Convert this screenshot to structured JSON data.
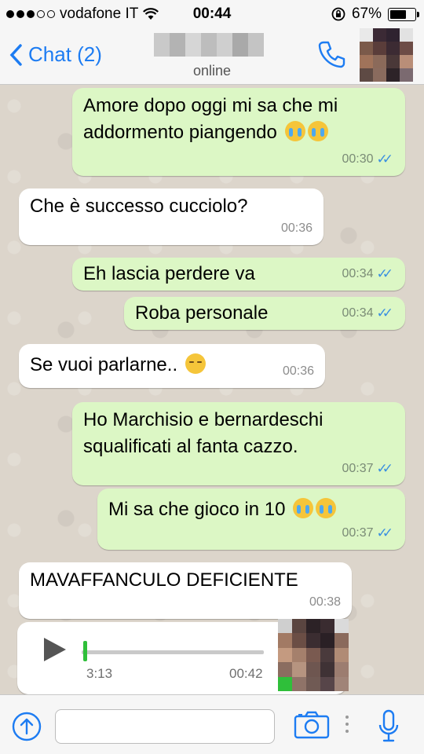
{
  "status_bar": {
    "carrier": "vodafone IT",
    "time": "00:44",
    "battery": "67%",
    "battery_level": 0.67,
    "signal_bars": 3
  },
  "header": {
    "back_label": "Chat (2)",
    "contact_status": "online"
  },
  "icons": {
    "back": "chevron-left-icon",
    "call": "phone-icon",
    "share": "upload-icon",
    "camera": "camera-icon",
    "mic": "microphone-icon",
    "play": "play-icon"
  },
  "colors": {
    "accent": "#1d7cf2",
    "outgoing_bubble": "#dcf7c5",
    "incoming_bubble": "#ffffff",
    "read_ticks": "#3a8fe0",
    "voice_progress": "#2fbf3a"
  },
  "messages": [
    {
      "direction": "out",
      "lines": [
        "Amore dopo oggi mi sa che mi",
        "addormento piangendo"
      ],
      "emoji": "crying-emoji crying-emoji",
      "time": "00:30",
      "read": true
    },
    {
      "direction": "in",
      "lines": [
        "Che è successo cucciolo?"
      ],
      "time": "00:36"
    },
    {
      "direction": "out",
      "lines": [
        "Eh lascia perdere va"
      ],
      "time": "00:34",
      "read": true
    },
    {
      "direction": "out",
      "lines": [
        "Roba personale"
      ],
      "time": "00:34",
      "read": true
    },
    {
      "direction": "in",
      "lines": [
        "Se vuoi parlarne.."
      ],
      "emoji": "pensive-emoji",
      "time": "00:36"
    },
    {
      "direction": "out",
      "lines": [
        "Ho Marchisio e bernardeschi",
        "squalificati al fanta cazzo."
      ],
      "time": "00:37",
      "read": true
    },
    {
      "direction": "out",
      "lines": [
        "Mi sa che gioco in 10"
      ],
      "emoji": "crying-emoji crying-emoji",
      "time": "00:37",
      "read": true
    },
    {
      "direction": "in",
      "lines": [
        "MAVAFFANCULO DEFICIENTE"
      ],
      "time": "00:38"
    }
  ],
  "voice_message": {
    "duration": "3:13",
    "time": "00:42",
    "progress": 0
  },
  "compose": {
    "placeholder": ""
  }
}
